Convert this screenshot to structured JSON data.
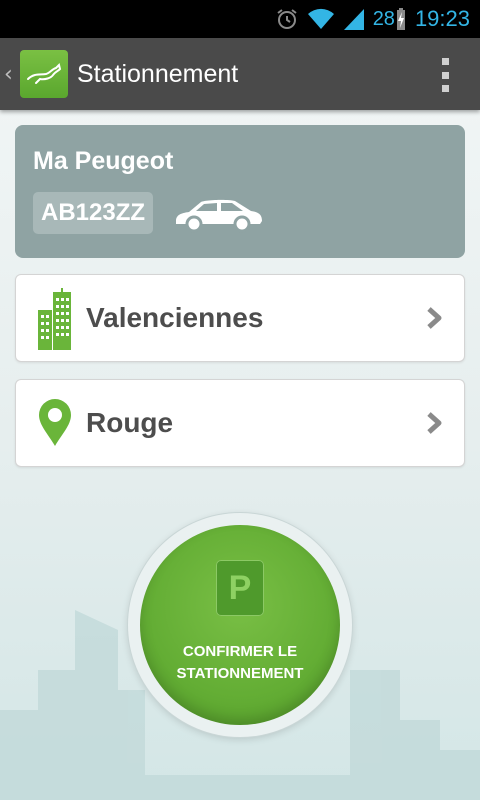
{
  "status_bar": {
    "battery_level": "28",
    "time": "19:23",
    "icons": [
      "alarm-icon",
      "wifi-icon",
      "signal-icon",
      "battery-charging-icon"
    ]
  },
  "action_bar": {
    "title": "Stationnement",
    "logo_icon": "kangaroo-logo-icon",
    "accent_color": "#6ab53a",
    "background_color": "#4a4a4a"
  },
  "vehicle": {
    "name": "Ma Peugeot",
    "plate": "AB123ZZ",
    "icon": "car-icon"
  },
  "selections": [
    {
      "label": "Valenciennes",
      "icon": "city-buildings-icon"
    },
    {
      "label": "Rouge",
      "icon": "map-pin-icon"
    }
  ],
  "confirm": {
    "badge": "P",
    "line1": "CONFIRMER LE",
    "line2": "STATIONNEMENT",
    "color": "#63ad34"
  }
}
